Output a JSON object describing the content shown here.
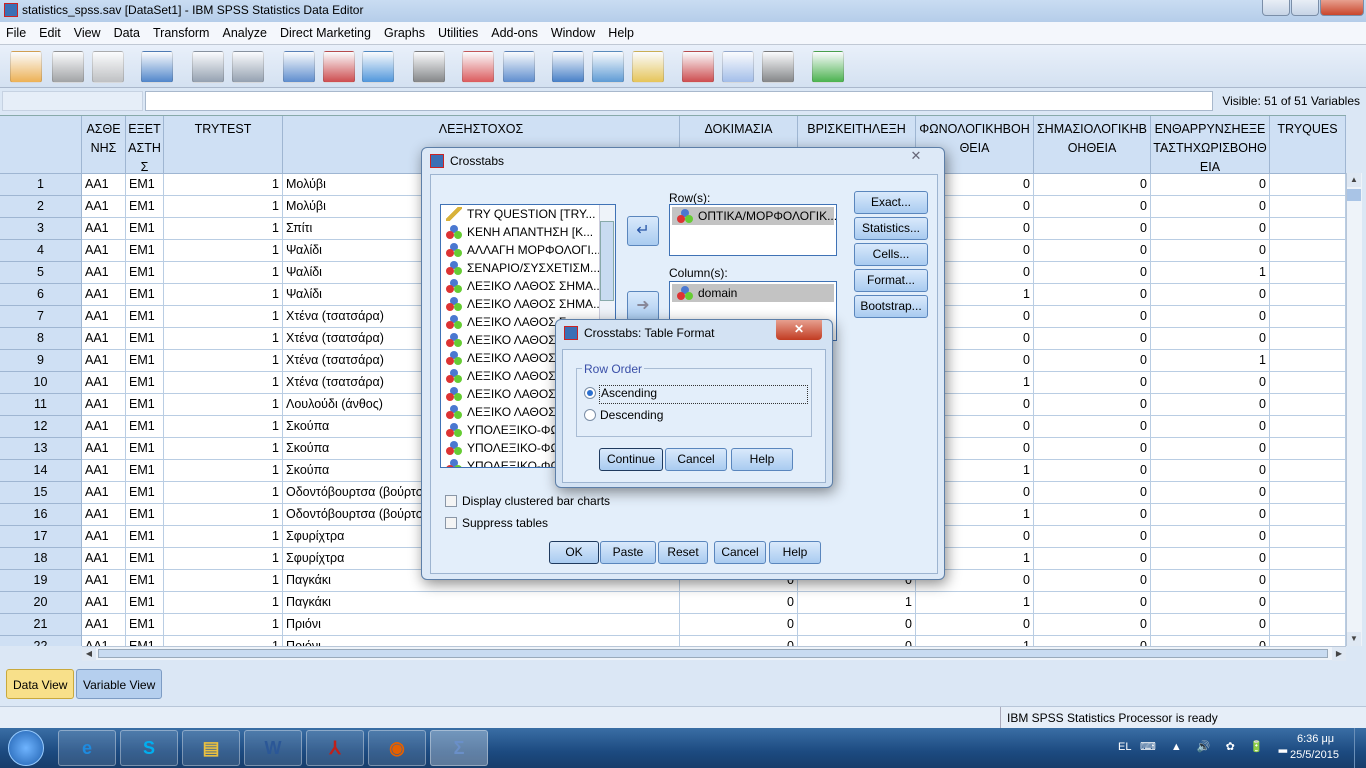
{
  "window": {
    "title": "statistics_spss.sav [DataSet1] - IBM SPSS Statistics Data Editor"
  },
  "menu": [
    "File",
    "Edit",
    "View",
    "Data",
    "Transform",
    "Analyze",
    "Direct Marketing",
    "Graphs",
    "Utilities",
    "Add-ons",
    "Window",
    "Help"
  ],
  "toolbar_icons": [
    "open-folder-icon",
    "save-icon",
    "print-icon",
    "dialog-recall-icon",
    "undo-icon",
    "redo-icon",
    "goto-case-icon",
    "goto-variable-icon",
    "variables-icon",
    "find-icon",
    "insert-cases-icon",
    "insert-variable-icon",
    "split-file-icon",
    "weight-cases-icon",
    "select-cases-icon",
    "value-labels-icon",
    "use-sets-icon",
    "show-all-variables-icon",
    "spell-check-icon"
  ],
  "editor": {
    "cell_ref": "",
    "cell_value": "",
    "visible": "Visible: 51 of 51 Variables"
  },
  "grid": {
    "columns": [
      "ΑΣΘΕ ΝΗΣ",
      "ΕΞΕΤ ΑΣΤΗ Σ",
      "TRYTEST",
      "ΛΕΞΗΣΤΟΧΟΣ",
      "ΔΟΚΙΜΑΣΙΑ",
      "ΒΡΙΣΚΕΙΤΗΛΕΞΗ",
      "ΦΩΝΟΛΟΓΙΚΗΒΟΗ ΘΕΙΑ",
      "ΣΗΜΑΣΙΟΛΟΓΙΚΗΒ ΟΗΘΕΙΑ",
      "ΕΝΘΑΡΡΥΝΣΗΕΞΕ ΤΑΣΤΗΧΩΡΙΣΒΟΗΘ ΕΙΑ",
      "TRYQUES"
    ],
    "rows": [
      [
        "1",
        "AA1",
        "EM1",
        "1",
        "Μολύβι",
        "",
        "",
        "0",
        "0",
        "0",
        ""
      ],
      [
        "2",
        "AA1",
        "EM1",
        "1",
        "Μολύβι",
        "",
        "",
        "0",
        "0",
        "0",
        ""
      ],
      [
        "3",
        "AA1",
        "EM1",
        "1",
        "Σπίτι",
        "",
        "",
        "0",
        "0",
        "0",
        ""
      ],
      [
        "4",
        "AA1",
        "EM1",
        "1",
        "Ψαλίδι",
        "",
        "",
        "0",
        "0",
        "0",
        ""
      ],
      [
        "5",
        "AA1",
        "EM1",
        "1",
        "Ψαλίδι",
        "",
        "",
        "0",
        "0",
        "1",
        ""
      ],
      [
        "6",
        "AA1",
        "EM1",
        "1",
        "Ψαλίδι",
        "",
        "",
        "1",
        "0",
        "0",
        ""
      ],
      [
        "7",
        "AA1",
        "EM1",
        "1",
        "Χτένα (τσατσάρα)",
        "",
        "",
        "0",
        "0",
        "0",
        ""
      ],
      [
        "8",
        "AA1",
        "EM1",
        "1",
        "Χτένα (τσατσάρα)",
        "",
        "",
        "0",
        "0",
        "0",
        ""
      ],
      [
        "9",
        "AA1",
        "EM1",
        "1",
        "Χτένα (τσατσάρα)",
        "",
        "",
        "0",
        "0",
        "1",
        ""
      ],
      [
        "10",
        "AA1",
        "EM1",
        "1",
        "Χτένα (τσατσάρα)",
        "",
        "",
        "1",
        "0",
        "0",
        ""
      ],
      [
        "11",
        "AA1",
        "EM1",
        "1",
        "Λουλούδι (άνθος)",
        "",
        "",
        "0",
        "0",
        "0",
        ""
      ],
      [
        "12",
        "AA1",
        "EM1",
        "1",
        "Σκούπα",
        "",
        "",
        "0",
        "0",
        "0",
        ""
      ],
      [
        "13",
        "AA1",
        "EM1",
        "1",
        "Σκούπα",
        "",
        "",
        "0",
        "0",
        "0",
        ""
      ],
      [
        "14",
        "AA1",
        "EM1",
        "1",
        "Σκούπα",
        "",
        "",
        "1",
        "0",
        "0",
        ""
      ],
      [
        "15",
        "AA1",
        "EM1",
        "1",
        "Οδοντόβουρτσα (βούρτσα",
        "",
        "",
        "0",
        "0",
        "0",
        ""
      ],
      [
        "16",
        "AA1",
        "EM1",
        "1",
        "Οδοντόβουρτσα (βούρτσα",
        "",
        "",
        "1",
        "0",
        "0",
        ""
      ],
      [
        "17",
        "AA1",
        "EM1",
        "1",
        "Σφυρίχτρα",
        "",
        "",
        "0",
        "0",
        "0",
        ""
      ],
      [
        "18",
        "AA1",
        "EM1",
        "1",
        "Σφυρίχτρα",
        "",
        "",
        "1",
        "0",
        "0",
        ""
      ],
      [
        "19",
        "AA1",
        "EM1",
        "1",
        "Παγκάκι",
        "0",
        "0",
        "0",
        "0",
        "0",
        ""
      ],
      [
        "20",
        "AA1",
        "EM1",
        "1",
        "Παγκάκι",
        "0",
        "1",
        "1",
        "0",
        "0",
        ""
      ],
      [
        "21",
        "AA1",
        "EM1",
        "1",
        "Πριόνι",
        "0",
        "0",
        "0",
        "0",
        "0",
        ""
      ],
      [
        "22",
        "AA1",
        "EM1",
        "1",
        "Πριόνι",
        "0",
        "0",
        "1",
        "0",
        "0",
        ""
      ]
    ]
  },
  "tabs": {
    "data_view": "Data View",
    "variable_view": "Variable View"
  },
  "status": "IBM SPSS Statistics Processor is ready",
  "crosstabs": {
    "title": "Crosstabs",
    "variables": [
      {
        "label": "TRY QUESTION [TRY...",
        "type": "scale"
      },
      {
        "label": "ΚΕΝΗ ΑΠΑΝΤΗΣΗ [Κ...",
        "type": "nominal"
      },
      {
        "label": "ΑΛΛΑΓΗ ΜΟΡΦΟΛΟΓΙ...",
        "type": "nominal"
      },
      {
        "label": "ΣΕΝΑΡΙΟ/ΣΥΣΧΕΤΙΣΜ...",
        "type": "nominal"
      },
      {
        "label": "ΛΕΞΙΚΟ ΛΑΘΟΣ ΣΗΜΑ...",
        "type": "nominal"
      },
      {
        "label": "ΛΕΞΙΚΟ ΛΑΘΟΣ ΣΗΜΑ...",
        "type": "nominal"
      },
      {
        "label": "ΛΕΞΙΚΟ ΛΑΘΟΣ Σ",
        "type": "nominal"
      },
      {
        "label": "ΛΕΞΙΚΟ ΛΑΘΟΣ Σ",
        "type": "nominal"
      },
      {
        "label": "ΛΕΞΙΚΟ ΛΑΘΟΣ Σ",
        "type": "nominal"
      },
      {
        "label": "ΛΕΞΙΚΟ ΛΑΘΟΣ Ι",
        "type": "nominal"
      },
      {
        "label": "ΛΕΞΙΚΟ ΛΑΘΟΣ Ο",
        "type": "nominal"
      },
      {
        "label": "ΛΕΞΙΚΟ ΛΑΘΟΣ-Λ",
        "type": "nominal"
      },
      {
        "label": "ΥΠΟΛΕΞΙΚΟ-ΦΩ",
        "type": "nominal"
      },
      {
        "label": "ΥΠΟΛΕΞΙΚΟ-ΦΩ",
        "type": "nominal"
      },
      {
        "label": "ΥΠΟΛΕΞΙΚΟ-ΦΩ",
        "type": "nominal"
      }
    ],
    "rows_label": "Row(s):",
    "rows": [
      "ΟΠΤΙΚΑ/ΜΟΡΦΟΛΟΓΙΚ..."
    ],
    "columns_label": "Column(s):",
    "columns": [
      "domain"
    ],
    "side_buttons": [
      "Exact...",
      "Statistics...",
      "Cells...",
      "Format...",
      "Bootstrap..."
    ],
    "display_clustered": "Display clustered bar charts",
    "suppress_tables": "Suppress tables",
    "buttons": [
      "OK",
      "Paste",
      "Reset",
      "Cancel",
      "Help"
    ]
  },
  "table_format": {
    "title": "Crosstabs: Table Format",
    "group": "Row Order",
    "options": [
      "Ascending",
      "Descending"
    ],
    "selected": "Ascending",
    "buttons": [
      "Continue",
      "Cancel",
      "Help"
    ]
  },
  "taskbar": {
    "apps": [
      "internet-explorer-icon",
      "skype-icon",
      "file-explorer-icon",
      "word-icon",
      "acrobat-icon",
      "firefox-icon",
      "spss-icon"
    ],
    "lang": "EL",
    "time": "6:36 μμ",
    "date": "25/5/2015"
  }
}
